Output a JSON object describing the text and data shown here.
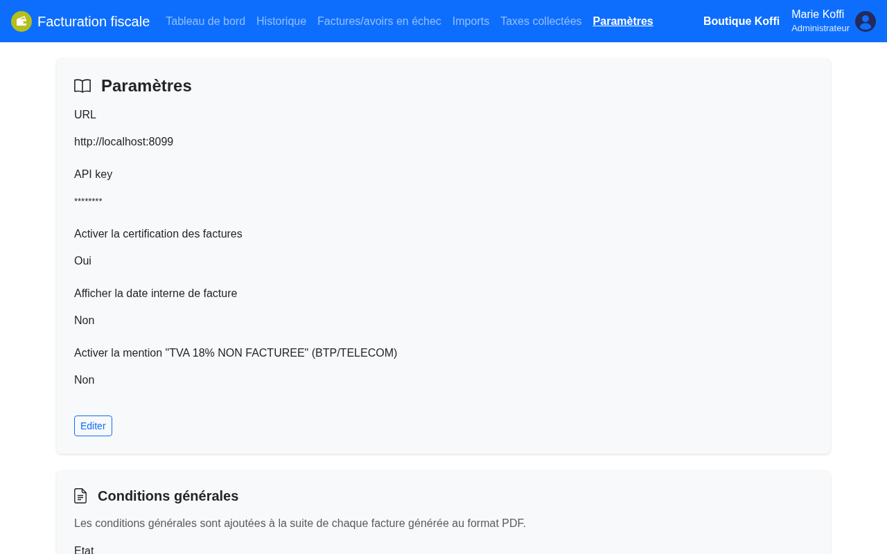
{
  "navbar": {
    "brand": "Facturation fiscale",
    "links": [
      {
        "label": "Tableau de bord",
        "selected": false
      },
      {
        "label": "Historique",
        "selected": false
      },
      {
        "label": "Factures/avoirs en échec",
        "selected": false
      },
      {
        "label": "Imports",
        "selected": false
      },
      {
        "label": "Taxes collectées",
        "selected": false
      },
      {
        "label": "Paramètres",
        "selected": true
      }
    ],
    "shop": "Boutique Koffi",
    "user": {
      "name": "Marie Koffi",
      "role": "Administrateur"
    }
  },
  "settings_card": {
    "title": "Paramètres",
    "fields": [
      {
        "label": "URL",
        "value": "http://localhost:8099",
        "kind": "text"
      },
      {
        "label": "API key",
        "value": "********",
        "kind": "masked"
      },
      {
        "label": "Activer la certification des factures",
        "value": "Oui",
        "kind": "text"
      },
      {
        "label": "Afficher la date interne de facture",
        "value": "Non",
        "kind": "text"
      },
      {
        "label": "Activer la mention \"TVA 18% NON FACTUREE\" (BTP/TELECOM)",
        "value": "Non",
        "kind": "text"
      }
    ],
    "button": "Editer"
  },
  "terms_card": {
    "title": "Conditions générales",
    "description": "Les conditions générales sont ajoutées à la suite de chaque facture générée au format PDF.",
    "fields": [
      {
        "label": "Etat"
      }
    ]
  }
}
